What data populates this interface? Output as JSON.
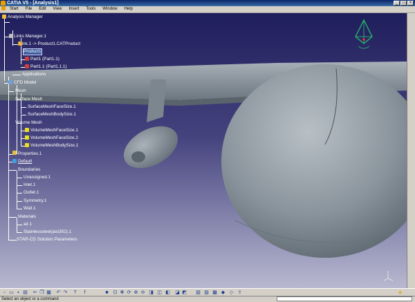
{
  "window": {
    "title": "CATIA V5 - [Analysis1]",
    "controls": [
      "_",
      "□",
      "×"
    ]
  },
  "menu": [
    "Start",
    "File",
    "Edit",
    "View",
    "Insert",
    "Tools",
    "Window",
    "Help"
  ],
  "tree": {
    "root": "Analysis Manager",
    "links_manager": "Links Manager.1",
    "link": "Link.1 -> Product1.CATProduct",
    "product": "Product1",
    "part1": "Part1 (Part1.1)",
    "part2": "Part1.1 (Part1.1.1)",
    "applications": "Applications",
    "cfd_model": "CFD Model",
    "mesh": "Mesh",
    "surface_mesh": "Surface Mesh",
    "surface_face": "SurfaceMeshFaceSize.1",
    "surface_body": "SurfaceMeshBodySize.1",
    "volume_mesh": "Volume Mesh",
    "volume_face1": "VolumeMeshFaceSize.1",
    "volume_face2": "VolumeMeshFaceSize.2",
    "volume_body": "VolumeMeshBodySize.1",
    "properties": "Properties.1",
    "default": "Default",
    "boundaries": "Boundaries",
    "unassigned": "Unassigned.1",
    "inlet": "Inlet.1",
    "outlet": "Outlet.1",
    "symmetry": "Symmetry.1",
    "wall": "Wall.1",
    "materials": "Materials",
    "air": "air.1",
    "steel": "Stainlesssteel(aisi302).1",
    "solution": "STAR-CD Solution Parameters"
  },
  "status": {
    "message": "Select an object or a command"
  },
  "colors": {
    "background_top": "#1f1e5c",
    "background_bottom": "#b8b8d0",
    "aircraft": "#8a949c",
    "tree_text": "#ffffff"
  }
}
